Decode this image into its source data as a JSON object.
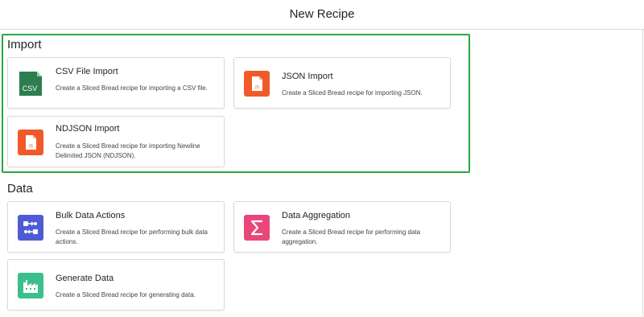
{
  "header": {
    "title": "New Recipe"
  },
  "sections": {
    "import": {
      "title": "Import",
      "cards": [
        {
          "title": "CSV File Import",
          "description": "Create a Sliced Bread recipe for importing a CSV file.",
          "icon": "csv-file-icon",
          "icon_label": "CSV",
          "color": "#2e7d4f"
        },
        {
          "title": "JSON Import",
          "description": "Create a Sliced Bread recipe for importing JSON.",
          "icon": "json-file-icon",
          "icon_label": "JS",
          "color": "#f05a2a"
        },
        {
          "title": "NDJSON Import",
          "description": "Create a Sliced Bread recipe for importing Newline Delimited JSON (NDJSON).",
          "icon": "ndjson-file-icon",
          "icon_label": "JS",
          "color": "#f05a2a"
        }
      ]
    },
    "data": {
      "title": "Data",
      "cards": [
        {
          "title": "Bulk Data Actions",
          "description": "Create a Sliced Bread recipe for performing bulk data actions.",
          "icon": "bulk-actions-icon",
          "color": "#4f5bd5"
        },
        {
          "title": "Data Aggregation",
          "description": "Create a Sliced Bread recipe for performing data aggregation.",
          "icon": "sigma-icon",
          "color": "#e9467a"
        },
        {
          "title": "Generate Data",
          "description": "Create a Sliced Bread recipe for generating data.",
          "icon": "factory-icon",
          "color": "#3bbf8c"
        }
      ]
    }
  },
  "colors": {
    "highlight": "#28a745"
  }
}
